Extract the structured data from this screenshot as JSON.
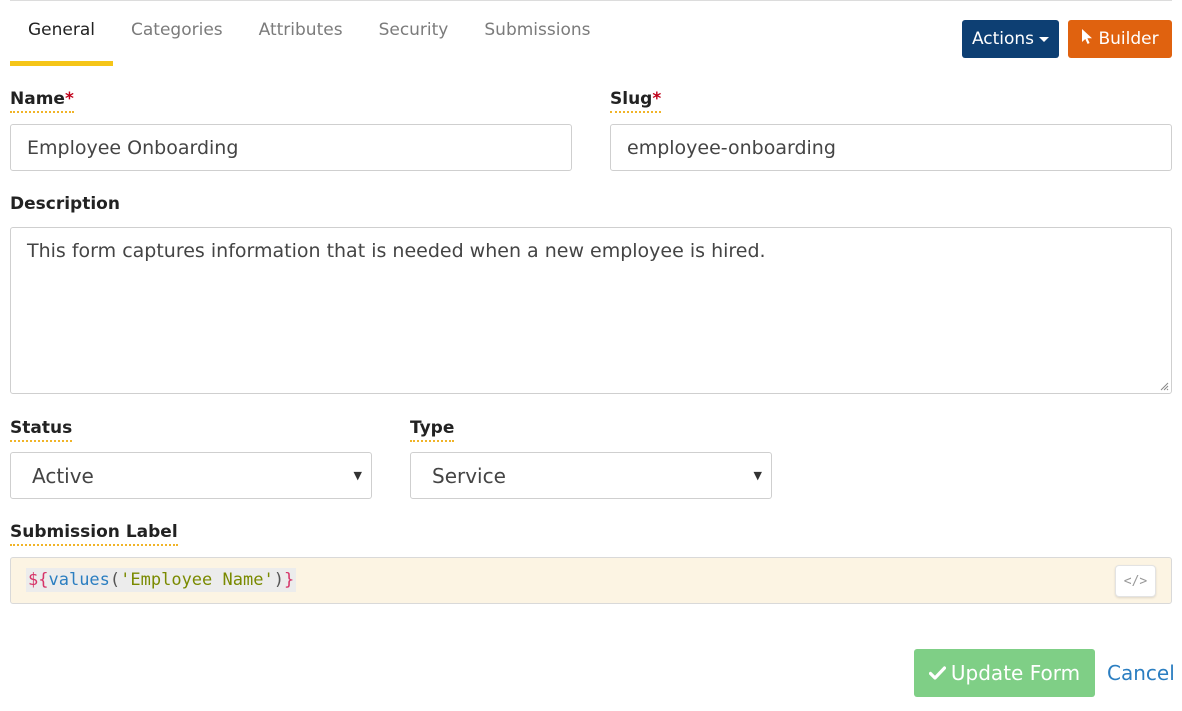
{
  "tabs": [
    {
      "label": "General",
      "active": true
    },
    {
      "label": "Categories"
    },
    {
      "label": "Attributes"
    },
    {
      "label": "Security"
    },
    {
      "label": "Submissions"
    }
  ],
  "header": {
    "actions_label": "Actions",
    "builder_label": "Builder"
  },
  "form": {
    "name_label": "Name",
    "required_mark": "*",
    "name_value": "Employee Onboarding",
    "slug_label": "Slug",
    "slug_value": "employee-onboarding",
    "description_label": "Description",
    "description_value": "This form captures information that is needed when a new employee is hired.",
    "status_label": "Status",
    "status_value": "Active",
    "type_label": "Type",
    "type_value": "Service",
    "submission_label_label": "Submission Label",
    "submission_label_code": {
      "open": "${",
      "fn": "values",
      "paren_open": "(",
      "arg": "'Employee Name'",
      "paren_close": ")",
      "close": "}"
    },
    "code_toggle": "</>"
  },
  "footer": {
    "update_label": "Update Form",
    "cancel_label": "Cancel"
  },
  "colors": {
    "active_tab_underline": "#f5c518",
    "actions_bg": "#0d3f73",
    "builder_bg": "#e0620f",
    "update_bg": "#7fcf86",
    "link": "#2b7ec1",
    "required": "#c0001a"
  },
  "icons": {
    "builder": "cursor-pointer-icon",
    "update": "checkmark-icon",
    "code_toggle": "code-icon",
    "select_arrow": "caret-down-icon"
  }
}
